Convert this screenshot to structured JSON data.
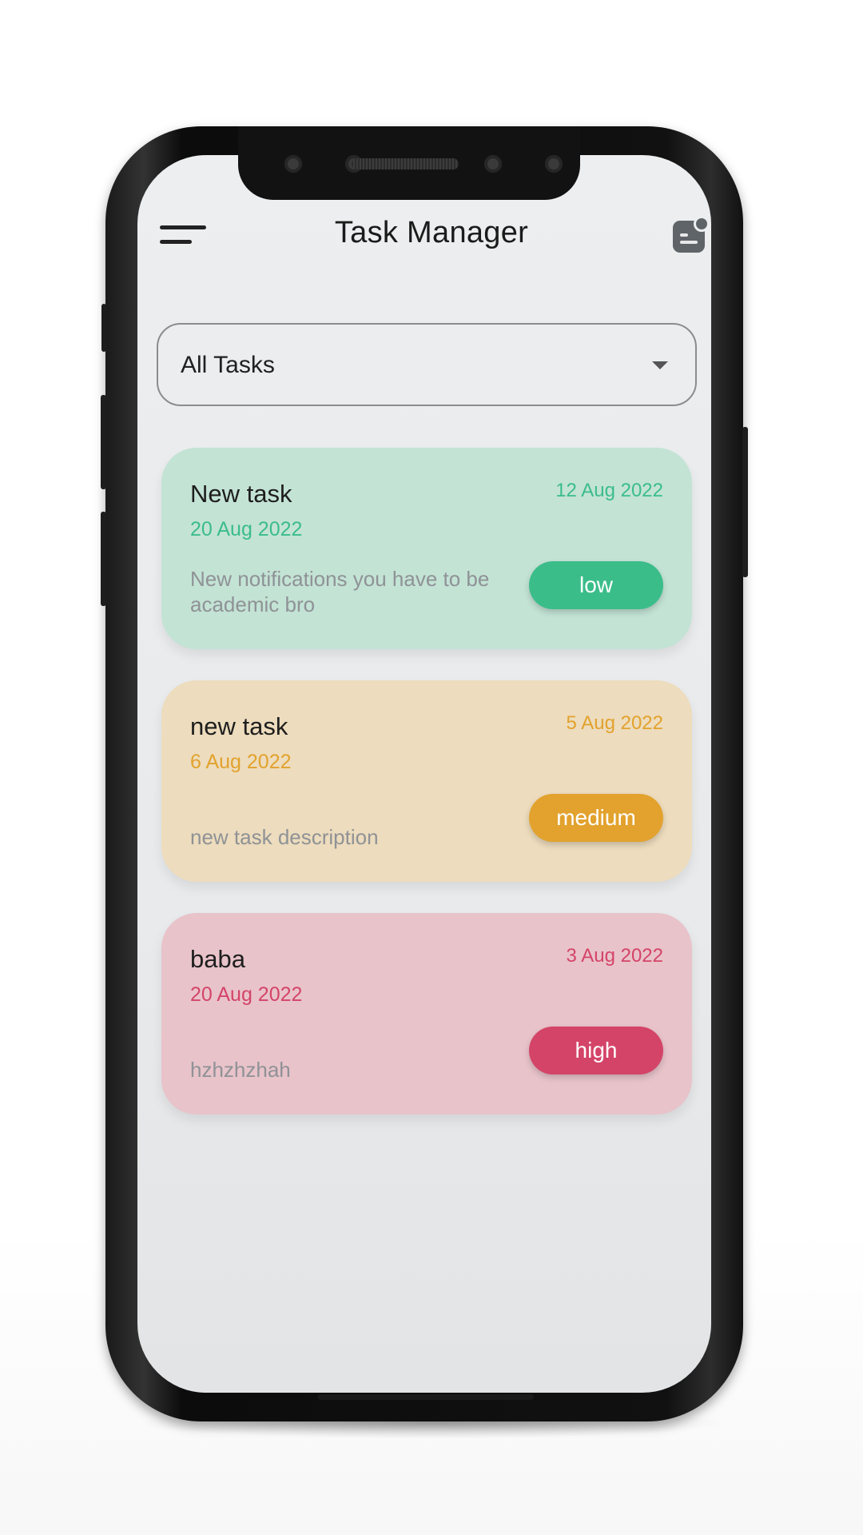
{
  "header": {
    "title": "Task Manager",
    "menu_icon": "hamburger-menu-icon",
    "notification_icon": "notification-icon"
  },
  "filter": {
    "selected": "All Tasks"
  },
  "tasks": [
    {
      "title": "New task",
      "start_date": "20 Aug 2022",
      "created_date": "12 Aug 2022",
      "description": "New notifications you have to be academic bro",
      "priority": "low",
      "colors": {
        "card": "#c3e3d5",
        "accent": "#3bbd8a"
      }
    },
    {
      "title": "new task",
      "start_date": "6 Aug 2022",
      "created_date": "5 Aug 2022",
      "description": "new task description",
      "priority": "medium",
      "colors": {
        "card": "#eddcbd",
        "accent": "#e2a22d"
      }
    },
    {
      "title": "baba",
      "start_date": "20 Aug 2022",
      "created_date": "3 Aug 2022",
      "description": "hzhzhzhah",
      "priority": "high",
      "colors": {
        "card": "#e8c3ca",
        "accent": "#d44468"
      }
    }
  ]
}
